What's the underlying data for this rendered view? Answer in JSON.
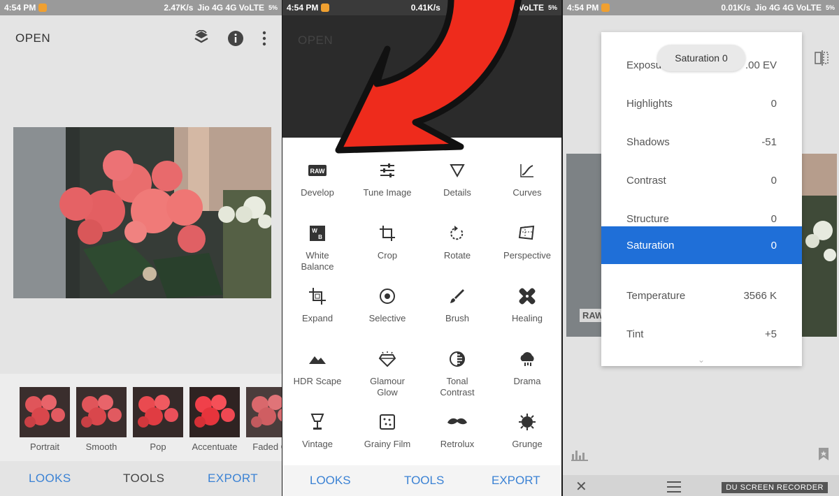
{
  "panel1": {
    "status": {
      "time": "4:54 PM",
      "speed": "2.47K/s",
      "carrier": "Jio 4G 4G VoLTE",
      "battery": "5%"
    },
    "open_label": "OPEN",
    "icons": [
      "layers-icon",
      "info-icon",
      "more-vert-icon"
    ],
    "looks": [
      {
        "label": "Portrait"
      },
      {
        "label": "Smooth"
      },
      {
        "label": "Pop"
      },
      {
        "label": "Accentuate"
      },
      {
        "label": "Faded Gl"
      }
    ],
    "tabs": {
      "looks": "LOOKS",
      "tools": "TOOLS",
      "export": "EXPORT"
    }
  },
  "panel2": {
    "status": {
      "time": "4:54 PM",
      "speed": "0.41K/s",
      "carrier": "VoLTE",
      "battery": "5%"
    },
    "open_label": "OPEN",
    "tools": [
      {
        "label": "Develop",
        "icon": "raw-icon"
      },
      {
        "label": "Tune Image",
        "icon": "sliders-icon"
      },
      {
        "label": "Details",
        "icon": "triangle-icon"
      },
      {
        "label": "Curves",
        "icon": "curves-icon"
      },
      {
        "label": "White Balance",
        "icon": "white-balance-icon"
      },
      {
        "label": "Crop",
        "icon": "crop-icon"
      },
      {
        "label": "Rotate",
        "icon": "rotate-icon"
      },
      {
        "label": "Perspective",
        "icon": "perspective-icon"
      },
      {
        "label": "Expand",
        "icon": "expand-icon"
      },
      {
        "label": "Selective",
        "icon": "selective-icon"
      },
      {
        "label": "Brush",
        "icon": "brush-icon"
      },
      {
        "label": "Healing",
        "icon": "healing-icon"
      },
      {
        "label": "HDR Scape",
        "icon": "mountain-icon"
      },
      {
        "label": "Glamour Glow",
        "icon": "diamond-icon"
      },
      {
        "label": "Tonal Contrast",
        "icon": "tonal-icon"
      },
      {
        "label": "Drama",
        "icon": "cloud-icon"
      },
      {
        "label": "Vintage",
        "icon": "lamp-icon"
      },
      {
        "label": "Grainy Film",
        "icon": "grain-icon"
      },
      {
        "label": "Retrolux",
        "icon": "mustache-icon"
      },
      {
        "label": "Grunge",
        "icon": "grunge-icon"
      }
    ],
    "tabs": {
      "looks": "LOOKS",
      "tools": "TOOLS",
      "export": "EXPORT"
    }
  },
  "panel3": {
    "status": {
      "time": "4:54 PM",
      "speed": "0.01K/s",
      "carrier": "Jio 4G 4G VoLTE",
      "battery": "5%"
    },
    "pill": "Saturation 0",
    "menu": [
      {
        "label": "Exposu",
        "value": ".00 EV"
      },
      {
        "label": "Highlights",
        "value": "0"
      },
      {
        "label": "Shadows",
        "value": "-51"
      },
      {
        "label": "Contrast",
        "value": "0"
      },
      {
        "label": "Structure",
        "value": "0"
      },
      {
        "label": "Saturation",
        "value": "0"
      },
      {
        "label": "Temperature",
        "value": "3566 K"
      },
      {
        "label": "Tint",
        "value": "+5"
      }
    ],
    "raw_badge": "RAW",
    "watermark": "DU SCREEN RECORDER"
  }
}
